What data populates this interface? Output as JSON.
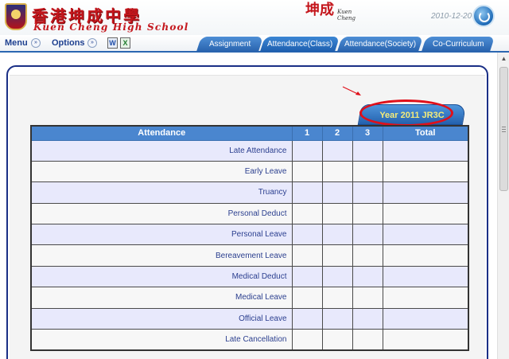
{
  "header": {
    "school_name_cn": "香港坤成中學",
    "school_name_en": "Kuen Cheng High School",
    "logo_text_cn": "坤成",
    "logo_small_text": "Kuen Cheng",
    "date": "2010-12-20"
  },
  "nav": {
    "menu_label": "Menu",
    "options_label": "Options",
    "word_icon_glyph": "W",
    "excel_icon_glyph": "X",
    "chevron_glyph": "»",
    "tabs": [
      {
        "label": "Assignment"
      },
      {
        "label": "Attendance(Class)"
      },
      {
        "label": "Attendance(Society)"
      },
      {
        "label": "Co-Curriculum"
      }
    ],
    "active_tab": "Attendance(Class)"
  },
  "year_tab": {
    "label": "Year 2011 JR3C",
    "circle_color": "#e0101a",
    "text_color": "#f5ec7a"
  },
  "table": {
    "headers": [
      "Attendance",
      "1",
      "2",
      "3",
      "Total"
    ],
    "rows": [
      {
        "label": "Late Attendance"
      },
      {
        "label": "Early Leave"
      },
      {
        "label": "Truancy"
      },
      {
        "label": "Personal Deduct"
      },
      {
        "label": "Personal Leave"
      },
      {
        "label": "Bereavement Leave"
      },
      {
        "label": "Medical Deduct"
      },
      {
        "label": "Medical Leave"
      },
      {
        "label": "Official Leave"
      },
      {
        "label": "Late Cancellation"
      }
    ]
  },
  "colors": {
    "brand_red": "#c4161c",
    "nav_blue": "#2862ad",
    "header_blue": "#4a86cf",
    "row_odd": "#e8e9fc",
    "row_even": "#f7f7f7",
    "panel_border": "#1a2f86"
  }
}
